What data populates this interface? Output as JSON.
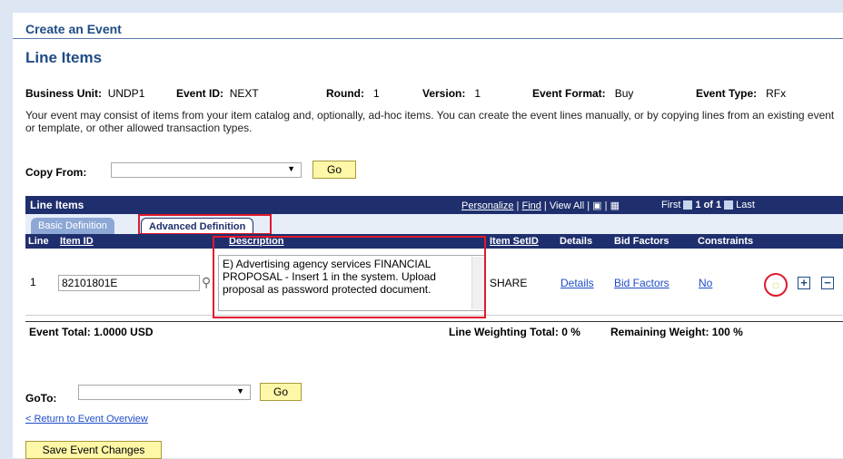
{
  "header": {
    "page_title": "Create an Event",
    "section_title": "Line Items"
  },
  "event_info": [
    {
      "label": "Business Unit:",
      "value": "UNDP1"
    },
    {
      "label": "Event ID:",
      "value": "NEXT"
    },
    {
      "label": "Round:",
      "value": "1"
    },
    {
      "label": "Version:",
      "value": "1"
    },
    {
      "label": "Event Format:",
      "value": "Buy"
    },
    {
      "label": "Event Type:",
      "value": "RFx"
    }
  ],
  "intro_text": "Your event may consist of items from your item catalog and, optionally, ad-hoc items.  You can create the event lines manually, or by copying lines from an existing event or template, or other allowed transaction types.",
  "copy_from": {
    "label": "Copy From:",
    "value": "",
    "go_label": "Go"
  },
  "grid": {
    "title": "Line Items",
    "personalize": "Personalize",
    "find": "Find",
    "view_all": "View All",
    "first": "First",
    "count": "1 of 1",
    "last": "Last",
    "tabs": [
      "Basic Definition",
      "Advanced Definition"
    ],
    "columns": [
      "Line",
      "Item ID",
      "Description",
      "Item SetID",
      "Details",
      "Bid Factors",
      "Constraints"
    ],
    "rows": [
      {
        "line": "1",
        "item_id": "82101801E",
        "description": "E) Advertising agency services FINANCIAL PROPOSAL - Insert 1 in the system. Upload proposal as password protected document.",
        "item_setid": "SHARE",
        "details": "Details",
        "bid_factors": "Bid Factors",
        "constraints": "No"
      }
    ]
  },
  "totals": {
    "event_total": "Event Total: 1.0000 USD",
    "line_weighting": "Line Weighting Total: 0 %",
    "remaining_weight": "Remaining Weight: 100 %"
  },
  "goto": {
    "label": "GoTo:",
    "value": "",
    "go_label": "Go"
  },
  "return_link": "< Return to Event Overview",
  "save_button": "Save Event Changes",
  "colors": {
    "brand": "#1f2f6e",
    "link": "#1f4cc8",
    "highlight": "#e0192d",
    "button": "#fff7a8"
  }
}
